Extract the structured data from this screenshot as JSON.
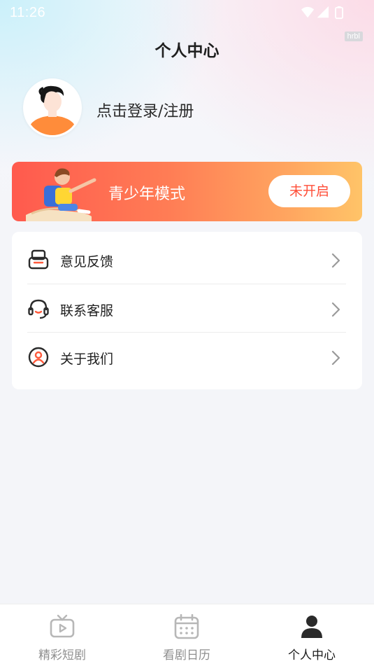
{
  "status_bar": {
    "time": "11:26",
    "icons": [
      "wifi-icon",
      "signal-icon",
      "battery-icon"
    ],
    "badge": "hrbl"
  },
  "header": {
    "title": "个人中心"
  },
  "profile": {
    "avatar_icon": "default-avatar",
    "login_text": "点击登录/注册"
  },
  "teen_mode": {
    "label": "青少年模式",
    "button_label": "未开启",
    "colors": {
      "gradient_start": "#ff5a4e",
      "gradient_end": "#ffc468",
      "button_text": "#ff4d37"
    }
  },
  "menu": {
    "items": [
      {
        "icon": "feedback-icon",
        "label": "意见反馈"
      },
      {
        "icon": "headset-icon",
        "label": "联系客服"
      },
      {
        "icon": "user-circle-icon",
        "label": "关于我们"
      }
    ]
  },
  "tabbar": {
    "active_index": 2,
    "tabs": [
      {
        "icon": "tv-play-icon",
        "label": "精彩短剧"
      },
      {
        "icon": "calendar-icon",
        "label": "看剧日历"
      },
      {
        "icon": "person-icon",
        "label": "个人中心"
      }
    ]
  }
}
